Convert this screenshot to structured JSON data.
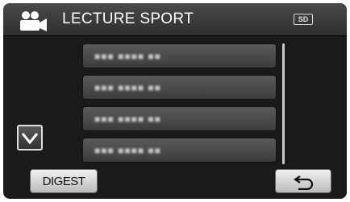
{
  "header": {
    "mode_icon": "video-camera-icon",
    "title": "LECTURE SPORT",
    "media_badge": "SD"
  },
  "list": {
    "items": [
      {
        "label": "■■■ ■■■■ ■■"
      },
      {
        "label": "■■■ ■■■■ ■■"
      },
      {
        "label": "■■■ ■■■■ ■■"
      },
      {
        "label": "■■■ ■■■■ ■■"
      }
    ]
  },
  "controls": {
    "scroll_down_icon": "chevron-down-icon",
    "digest_label": "DIGEST",
    "back_icon": "return-arrow-icon"
  }
}
